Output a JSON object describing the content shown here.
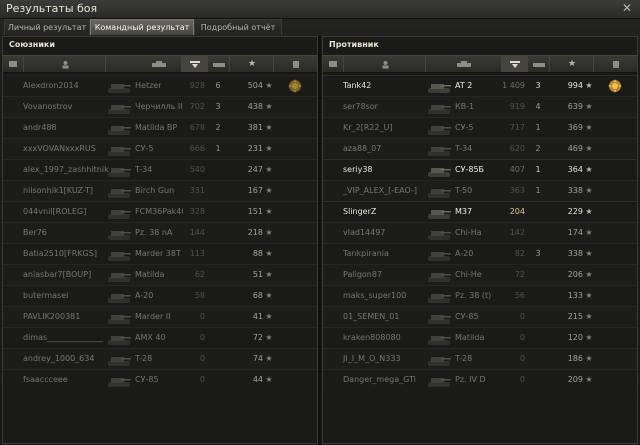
{
  "window": {
    "title": "Результаты боя"
  },
  "tabs": [
    {
      "label": "Личный результат"
    },
    {
      "label": "Командный результат"
    },
    {
      "label": "Подробный отчёт"
    }
  ],
  "allies": {
    "title": "Союзники",
    "rows": [
      {
        "player": "Alexdron2014",
        "tank": "Hetzer",
        "damage": "928",
        "kills": "6",
        "xp": "504",
        "alive": false,
        "badge": true
      },
      {
        "player": "Vovanostrov",
        "tank": "Черчилль III",
        "damage": "702",
        "kills": "3",
        "xp": "438",
        "alive": false,
        "me": true
      },
      {
        "player": "andr488",
        "tank": "Matilda BP",
        "damage": "678",
        "kills": "2",
        "xp": "381",
        "alive": false
      },
      {
        "player": "xxxVOVANxxxRUS",
        "tank": "СУ-5",
        "damage": "666",
        "kills": "1",
        "xp": "231",
        "alive": false
      },
      {
        "player": "alex_1997_zashhitnik",
        "tank": "T-34",
        "damage": "540",
        "kills": "",
        "xp": "247",
        "alive": false
      },
      {
        "player": "nilsonhik1[KUZ-T]",
        "tank": "Birch Gun",
        "damage": "331",
        "kills": "",
        "xp": "167",
        "alive": false
      },
      {
        "player": "044vnil[ROLEG]",
        "tank": "FCM36Pak40",
        "damage": "328",
        "kills": "",
        "xp": "151",
        "alive": false
      },
      {
        "player": "Ber76",
        "tank": "Pz. 38 nA",
        "damage": "144",
        "kills": "",
        "xp": "218",
        "alive": false
      },
      {
        "player": "Batia2510[FRKGS]",
        "tank": "Marder 38T",
        "damage": "113",
        "kills": "",
        "xp": "88",
        "alive": false
      },
      {
        "player": "aniasbar7[BOUP]",
        "tank": "Matilda",
        "damage": "62",
        "kills": "",
        "xp": "51",
        "alive": false
      },
      {
        "player": "butermasei",
        "tank": "A-20",
        "damage": "58",
        "kills": "",
        "xp": "68",
        "alive": false
      },
      {
        "player": "PAVLIK200381",
        "tank": "Marder II",
        "damage": "0",
        "kills": "",
        "xp": "41",
        "alive": false
      },
      {
        "player": "dimas______________",
        "tank": "AMX 40",
        "damage": "0",
        "kills": "",
        "xp": "72",
        "alive": false
      },
      {
        "player": "andrey_1000_634",
        "tank": "T-28",
        "damage": "0",
        "kills": "",
        "xp": "74",
        "alive": false
      },
      {
        "player": "fsaaccceee",
        "tank": "СУ-85",
        "damage": "0",
        "kills": "",
        "xp": "44",
        "alive": false
      }
    ]
  },
  "enemies": {
    "title": "Противник",
    "rows": [
      {
        "player": "Tank42",
        "tank": "AT 2",
        "damage": "1 409",
        "kills": "3",
        "xp": "994",
        "alive": true,
        "badge": true,
        "hl": false
      },
      {
        "player": "ser78sor",
        "tank": "КВ-1",
        "damage": "919",
        "kills": "4",
        "xp": "639",
        "alive": false
      },
      {
        "player": "Kr_2[R22_U]",
        "tank": "СУ-5",
        "damage": "717",
        "kills": "1",
        "xp": "369",
        "alive": false
      },
      {
        "player": "aza88_07",
        "tank": "T-34",
        "damage": "620",
        "kills": "2",
        "xp": "469",
        "alive": false
      },
      {
        "player": "seriy38",
        "tank": "СУ-85Б",
        "damage": "407",
        "kills": "1",
        "xp": "364",
        "alive": true
      },
      {
        "player": "_VIP_ALEX_[-EAO-]",
        "tank": "T-50",
        "damage": "363",
        "kills": "1",
        "xp": "338",
        "alive": false
      },
      {
        "player": "SlingerZ",
        "tank": "M37",
        "damage": "204",
        "kills": "",
        "xp": "229",
        "alive": true,
        "hl": true
      },
      {
        "player": "vlad14497",
        "tank": "Chi-Ha",
        "damage": "142",
        "kills": "",
        "xp": "174",
        "alive": false
      },
      {
        "player": "Tankpirania",
        "tank": "A-20",
        "damage": "82",
        "kills": "3",
        "xp": "338",
        "alive": false
      },
      {
        "player": "Paligon87",
        "tank": "Chi-He",
        "damage": "72",
        "kills": "",
        "xp": "206",
        "alive": false
      },
      {
        "player": "maks_super100",
        "tank": "Pz. 38 (t)",
        "damage": "56",
        "kills": "",
        "xp": "133",
        "alive": false
      },
      {
        "player": "01_SEMEN_01",
        "tank": "СУ-85",
        "damage": "0",
        "kills": "",
        "xp": "215",
        "alive": false
      },
      {
        "player": "kraken808080",
        "tank": "Matilda",
        "damage": "0",
        "kills": "",
        "xp": "120",
        "alive": false
      },
      {
        "player": "JI_I_M_O_N333",
        "tank": "T-28",
        "damage": "0",
        "kills": "",
        "xp": "186",
        "alive": false
      },
      {
        "player": "Danger_mega_GTi",
        "tank": "Pz. IV D",
        "damage": "0",
        "kills": "",
        "xp": "209",
        "alive": false
      }
    ]
  },
  "colors": {
    "accent": "#d8c888",
    "me_row": "#5a2e1b",
    "panel_border": "#3b3a35"
  },
  "icons": {
    "star": "★",
    "close": "✕"
  }
}
